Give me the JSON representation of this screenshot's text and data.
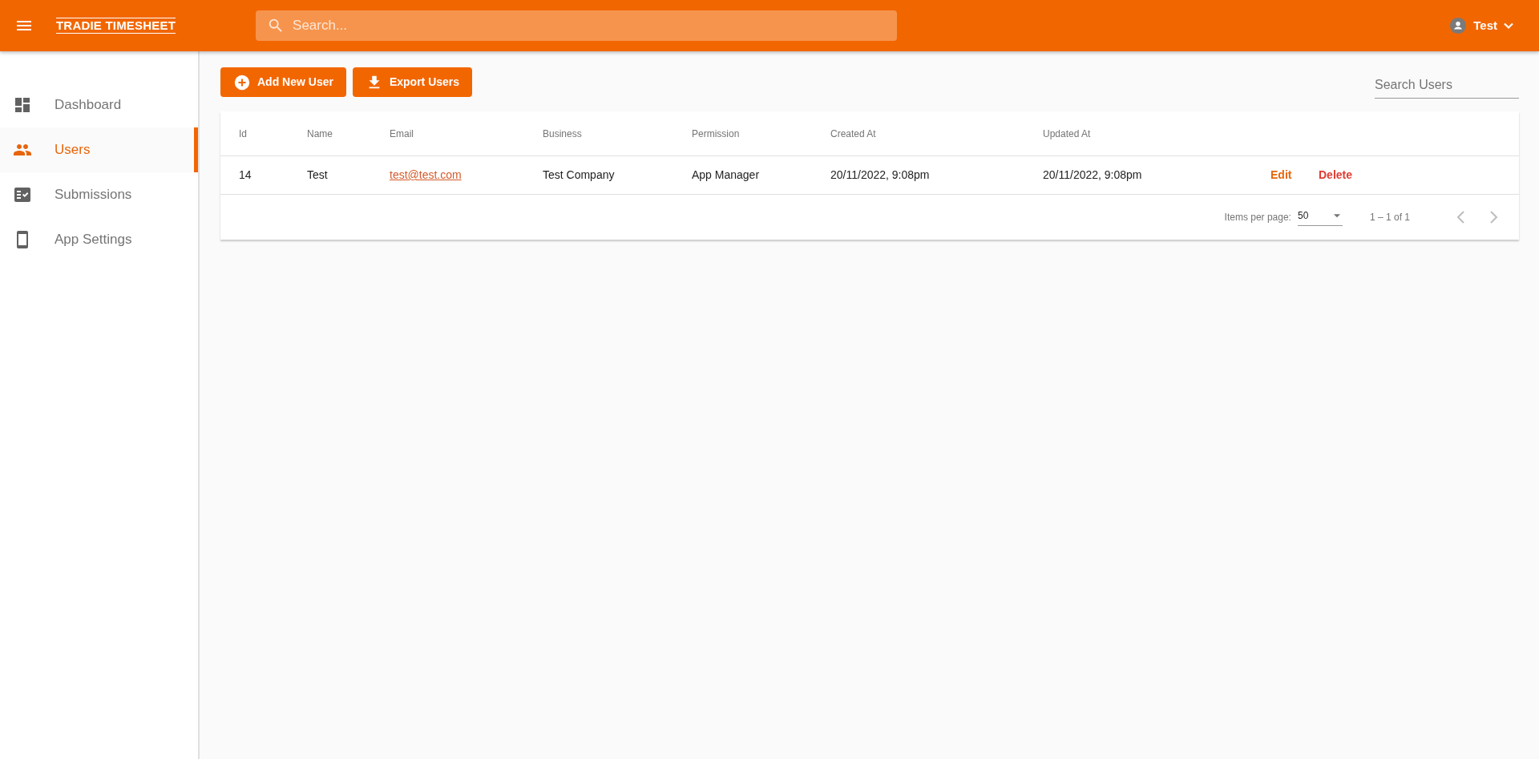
{
  "header": {
    "title": "TRADIE TIMESHEET",
    "search": {
      "placeholder": "Search..."
    },
    "user": {
      "name": "Test"
    }
  },
  "sidebar": {
    "items": [
      {
        "label": "Dashboard",
        "kind": "dashboard",
        "selected": false
      },
      {
        "label": "Users",
        "kind": "users",
        "selected": true
      },
      {
        "label": "Submissions",
        "kind": "checklist",
        "selected": false
      },
      {
        "label": "App Settings",
        "kind": "phone",
        "selected": false
      }
    ]
  },
  "toolbar": {
    "buttons": [
      {
        "label": "Add New User",
        "kind": "add"
      },
      {
        "label": "Export Users",
        "kind": "download"
      }
    ],
    "search": {
      "placeholder": "Search Users"
    }
  },
  "table": {
    "columns": [
      "Id",
      "Name",
      "Email",
      "Business",
      "Permission",
      "Created At",
      "Updated At"
    ],
    "rows": [
      {
        "id": "14",
        "name": "Test",
        "email": "test@test.com",
        "business": "Test Company",
        "permission": "App Manager",
        "created_at": "20/11/2022, 9:08pm",
        "updated_at": "20/11/2022, 9:08pm",
        "actions": [
          "Edit",
          "Delete"
        ]
      }
    ]
  },
  "paginator": {
    "items_per_page_label": "Items per page:",
    "items_per_page": "50",
    "range": "1 – 1 of 1",
    "prev_disabled": true,
    "next_disabled": true
  }
}
